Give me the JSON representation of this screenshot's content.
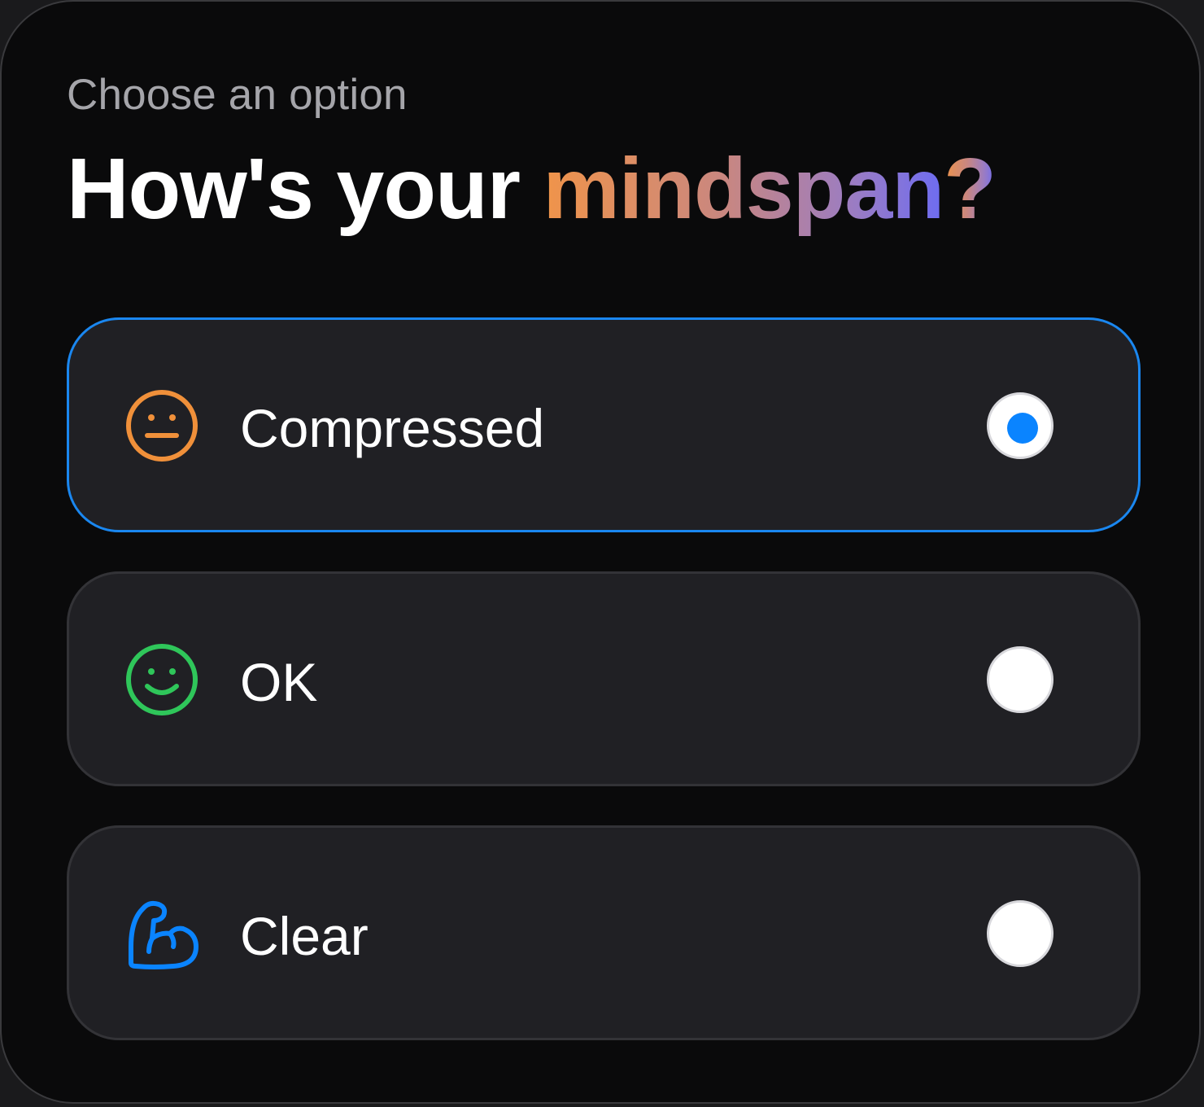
{
  "header": {
    "subtitle": "Choose an option",
    "title_prefix": "How's your ",
    "title_highlight": "mindspan",
    "title_suffix": "?"
  },
  "options": [
    {
      "label": "Compressed",
      "icon": "neutral-face-icon",
      "icon_color": "#f0903a",
      "selected": true
    },
    {
      "label": "OK",
      "icon": "smile-face-icon",
      "icon_color": "#2fc65a",
      "selected": false
    },
    {
      "label": "Clear",
      "icon": "flexed-bicep-icon",
      "icon_color": "#0a84ff",
      "selected": false
    }
  ],
  "colors": {
    "selected_border": "#1a87f0",
    "radio_selected_dot": "#0a84ff",
    "gradient_start": "#f0944a",
    "gradient_end": "#6d6cf2"
  }
}
